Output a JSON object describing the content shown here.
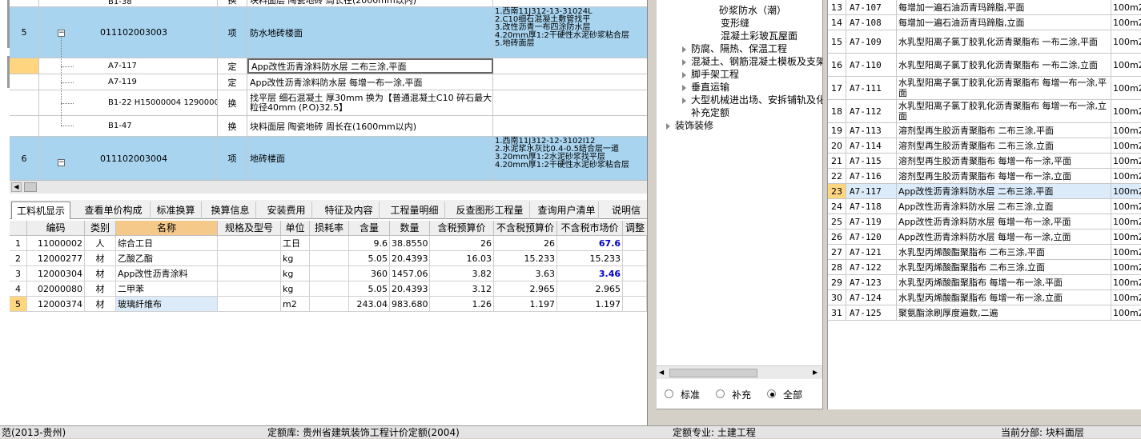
{
  "upper": {
    "row_partial": {
      "code": "B1-38",
      "type": "换",
      "name": "块料面层 陶瓷地砖 周长在(2000mm以内)"
    },
    "row5": {
      "num": "5",
      "code": "011102003003",
      "type": "项",
      "name": "防水地砖楼面",
      "features": "1.西南11J312-13-31024L\n2.C10细石混凝土敷管找平\n3.改性沥青一布四涂防水层\n4.20mm厚1:2干硬性水泥砂浆粘合层\n5.地砖面层"
    },
    "sub1": {
      "code": "A7-117",
      "type": "定",
      "name": "App改性沥青涂料防水层 二布三涂,平面"
    },
    "sub2": {
      "code": "A7-119",
      "type": "定",
      "name": "App改性沥青涂料防水层 每增一布一涂,平面"
    },
    "sub3": {
      "code": "B1-22 H15000004 12900001",
      "type": "换",
      "name": "找平层 细石混凝土 厚30mm 换为【普通混凝土C10 碎石最大粒径40mm (P.O)32.5】"
    },
    "sub4": {
      "code": "B1-47",
      "type": "换",
      "name": "块料面层 陶瓷地砖 周长在(1600mm以内)"
    },
    "row6": {
      "num": "6",
      "code": "011102003004",
      "type": "项",
      "name": "地砖楼面",
      "features": "1.西南11J312-12-3102I12\n2.水泥浆水灰比0.4-0.5结合层一道\n3.20mm厚1:2水泥砂浆找平层\n4.20mm厚1:2干硬性水泥砂浆粘合层"
    }
  },
  "tabs": [
    "工料机显示",
    "查看单价构成",
    "标准换算",
    "换算信息",
    "安装费用",
    "特征及内容",
    "工程量明细",
    "反查图形工程量",
    "查询用户清单",
    "说明信"
  ],
  "lower": {
    "headers": [
      "编码",
      "类别",
      "名称",
      "规格及型号",
      "单位",
      "损耗率",
      "含量",
      "数量",
      "含税预算价",
      "不含税预算价",
      "不含税市场价",
      "调整"
    ],
    "rows": [
      [
        "1",
        "11000002",
        "人",
        "综合工日",
        "",
        "工日",
        "",
        "9.6",
        "38.8550",
        "26",
        "26",
        "67.6"
      ],
      [
        "2",
        "12000277",
        "材",
        "乙酸乙酯",
        "",
        "kg",
        "",
        "5.05",
        "20.4393",
        "16.03",
        "15.233",
        "15.233"
      ],
      [
        "3",
        "12000304",
        "材",
        "App改性沥青涂料",
        "",
        "kg",
        "",
        "360",
        "1457.06",
        "3.82",
        "3.63",
        "3.46"
      ],
      [
        "4",
        "02000080",
        "材",
        "二甲苯",
        "",
        "kg",
        "",
        "5.05",
        "20.4393",
        "3.12",
        "2.965",
        "2.965"
      ],
      [
        "5",
        "12000374",
        "材",
        "玻璃纤维布",
        "",
        "m2",
        "",
        "243.04",
        "983.680",
        "1.26",
        "1.197",
        "1.197"
      ]
    ]
  },
  "tree": {
    "nodes": [
      "砂浆防水（潮）",
      "变形缝",
      "混凝土彩玻瓦屋面",
      "防腐、隔热、保温工程",
      "混凝土、钢筋混凝土模板及支架",
      "脚手架工程",
      "垂直运输",
      "大型机械进出场、安拆铺轨及化",
      "补充定额",
      "装饰装修"
    ],
    "radio": [
      "标准",
      "补充",
      "全部"
    ]
  },
  "right": {
    "rows": [
      [
        "13",
        "A7-107",
        "每增加一遍石油沥青玛蹄脂,平面",
        "100m2"
      ],
      [
        "14",
        "A7-108",
        "每增加一遍石油沥青玛蹄脂,立面",
        "100m2"
      ],
      [
        "15",
        "A7-109",
        "水乳型阳离子氯丁胶乳化沥青聚脂布 一布二涂,平面",
        "100m2"
      ],
      [
        "16",
        "A7-110",
        "水乳型阳离子氯丁胶乳化沥青聚脂布 一布二涂,立面",
        "100m2"
      ],
      [
        "17",
        "A7-111",
        "水乳型阳离子氯丁胶乳化沥青聚脂布 每增一布一涂,平面",
        "100m2"
      ],
      [
        "18",
        "A7-112",
        "水乳型阳离子氯丁胶乳化沥青聚脂布 每增一布一涂,立面",
        "100m2"
      ],
      [
        "19",
        "A7-113",
        "溶剂型再生胶沥青聚脂布 二布三涂,平面",
        "100m2"
      ],
      [
        "20",
        "A7-114",
        "溶剂型再生胶沥青聚脂布 二布三涂,立面",
        "100m2"
      ],
      [
        "21",
        "A7-115",
        "溶剂型再生胶沥青聚脂布 每增一布一涂,平面",
        "100m2"
      ],
      [
        "22",
        "A7-116",
        "溶剂型再生胶沥青聚脂布 每增一布一涂,立面",
        "100m2"
      ],
      [
        "23",
        "A7-117",
        "App改性沥青涂料防水层 二布三涂,平面",
        "100m2"
      ],
      [
        "24",
        "A7-118",
        "App改性沥青涂料防水层 二布三涂,立面",
        "100m2"
      ],
      [
        "25",
        "A7-119",
        "App改性沥青涂料防水层 每增一布一涂,平面",
        "100m2"
      ],
      [
        "26",
        "A7-120",
        "App改性沥青涂料防水层 每增一布一涂,立面",
        "100m2"
      ],
      [
        "27",
        "A7-121",
        "水乳型丙烯酸酯聚脂布 二布三涂,平面",
        "100m2"
      ],
      [
        "28",
        "A7-122",
        "水乳型丙烯酸酯聚脂布 二布三涂,立面",
        "100m2"
      ],
      [
        "29",
        "A7-123",
        "水乳型丙烯酸酯聚脂布 每增一布一涂,平面",
        "100m2"
      ],
      [
        "30",
        "A7-124",
        "水乳型丙烯酸酯聚脂布 每增一布一涂,立面",
        "100m2"
      ],
      [
        "31",
        "A7-125",
        "聚氨酯涂刷厚度遍数,二遍",
        "100m2"
      ]
    ]
  },
  "status": {
    "left": "范(2013-贵州)",
    "db": "定额库: 贵州省建筑装饰工程计价定额(2004)",
    "major": "定额专业: 土建工程",
    "part": "当前分部: 块料面层"
  }
}
